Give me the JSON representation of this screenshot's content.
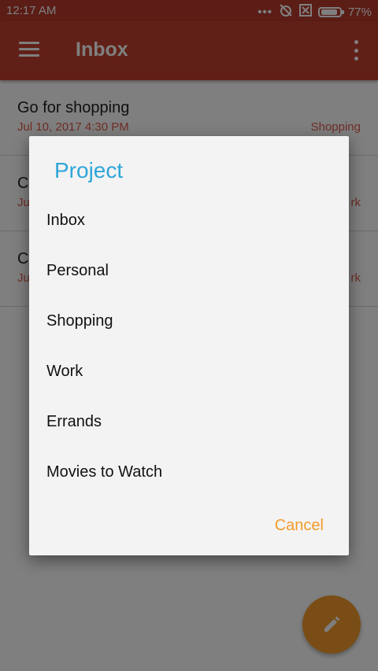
{
  "status_bar": {
    "time": "12:17  AM",
    "battery": "77%"
  },
  "app_bar": {
    "title": "Inbox"
  },
  "tasks": [
    {
      "name": "Go for shopping",
      "date": "Jul 10, 2017  4:30 PM",
      "project": "Shopping"
    },
    {
      "name": "C",
      "date": "Ju",
      "project": "rk"
    },
    {
      "name": "C",
      "date": "Ju",
      "project": "rk"
    }
  ],
  "dialog": {
    "title": "Project",
    "options": [
      "Inbox",
      "Personal",
      "Shopping",
      "Work",
      "Errands",
      "Movies to Watch"
    ],
    "cancel_label": "Cancel"
  },
  "colors": {
    "app_bar": "#c3402f",
    "status_bar": "#b73a2c",
    "accent": "#f39b2a",
    "dialog_title": "#2ea6d8",
    "task_meta": "#e05c4c"
  },
  "icons": {
    "menu": "hamburger-menu-icon",
    "more": "more-vert-icon",
    "fab": "pencil-icon"
  }
}
